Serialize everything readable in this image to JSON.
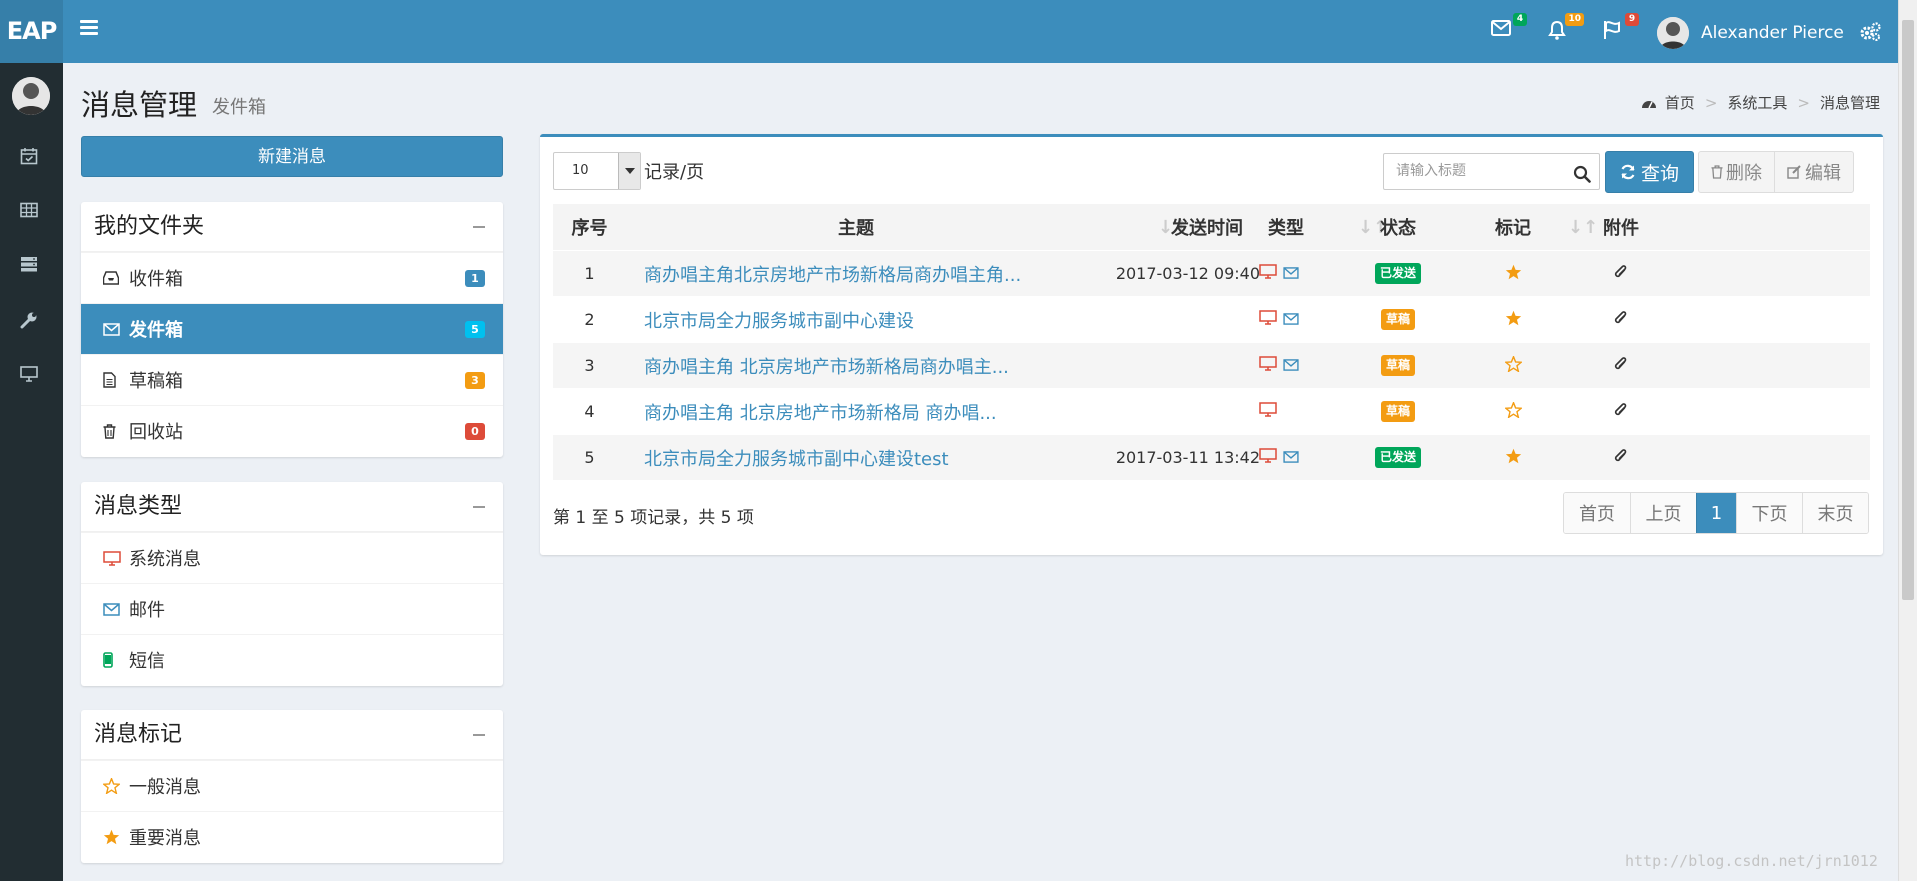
{
  "header": {
    "logo": "EAP",
    "mail_badge": "4",
    "bell_badge": "10",
    "flag_badge": "9",
    "user_name": "Alexander Pierce",
    "colors": {
      "primary": "#3c8dbc",
      "logo_bg": "#367fa9",
      "sidebar": "#222d32"
    }
  },
  "page": {
    "title": "消息管理",
    "subtitle": "发件箱"
  },
  "breadcrumb": {
    "home": "首页",
    "tools": "系统工具",
    "current": "消息管理"
  },
  "left": {
    "new_button": "新建消息",
    "folders": {
      "title": "我的文件夹",
      "items": [
        {
          "label": "收件箱",
          "icon": "inbox-icon",
          "count": "1",
          "badge_color": "#3c8dbc"
        },
        {
          "label": "发件箱",
          "icon": "envelope-icon",
          "count": "5",
          "badge_color": "#00c0ef"
        },
        {
          "label": "草稿箱",
          "icon": "file-icon",
          "count": "3",
          "badge_color": "#f39c12"
        },
        {
          "label": "回收站",
          "icon": "trash-icon",
          "count": "0",
          "badge_color": "#dd4b39"
        }
      ]
    },
    "types": {
      "title": "消息类型",
      "items": [
        {
          "label": "系统消息",
          "icon": "monitor-icon"
        },
        {
          "label": "邮件",
          "icon": "envelope-icon"
        },
        {
          "label": "短信",
          "icon": "mobile-icon"
        }
      ]
    },
    "marks": {
      "title": "消息标记",
      "items": [
        {
          "label": "一般消息",
          "icon": "star-outline-icon"
        },
        {
          "label": "重要消息",
          "icon": "star-icon"
        }
      ]
    }
  },
  "toolbar": {
    "page_size": "10",
    "per_page_label": "记录/页",
    "search_placeholder": "请输入标题",
    "query_label": "查询",
    "delete_label": "删除",
    "edit_label": "编辑"
  },
  "table": {
    "headers": {
      "seq": "序号",
      "subject": "主题",
      "time": "发送时间",
      "type": "类型",
      "status": "状态",
      "mark": "标记",
      "attach": "附件"
    },
    "rows": [
      {
        "seq": "1",
        "subject": "商办唱主角北京房地产市场新格局商办唱主角...",
        "time": "2017-03-12 09:40",
        "mail": true,
        "status": "已发送",
        "status_color": "#00a65a",
        "starred": true
      },
      {
        "seq": "2",
        "subject": "北京市局全力服务城市副中心建设",
        "time": "",
        "mail": true,
        "status": "草稿",
        "status_color": "#f39c12",
        "starred": true
      },
      {
        "seq": "3",
        "subject": "商办唱主角 北京房地产市场新格局商办唱主...",
        "time": "",
        "mail": true,
        "status": "草稿",
        "status_color": "#f39c12",
        "starred": false
      },
      {
        "seq": "4",
        "subject": "商办唱主角 北京房地产市场新格局 商办唱...",
        "time": "",
        "mail": false,
        "status": "草稿",
        "status_color": "#f39c12",
        "starred": false
      },
      {
        "seq": "5",
        "subject": "北京市局全力服务城市副中心建设test",
        "time": "2017-03-11 13:42",
        "mail": true,
        "status": "已发送",
        "status_color": "#00a65a",
        "starred": true
      }
    ]
  },
  "footer": {
    "info": "第 1 至 5 项记录，共 5 项",
    "pager": {
      "first": "首页",
      "prev": "上页",
      "current": "1",
      "next": "下页",
      "last": "末页"
    }
  },
  "watermark": "http://blog.csdn.net/jrn1012"
}
